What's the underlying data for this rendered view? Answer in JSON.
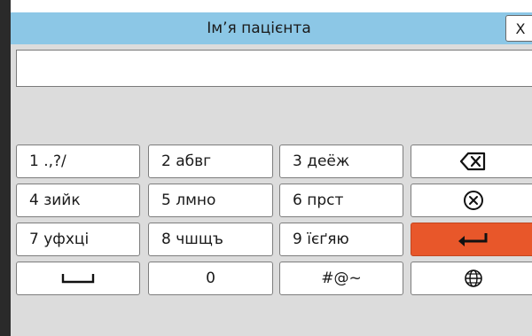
{
  "dialog": {
    "title": "Ім’я пацієнта",
    "close_label": "X"
  },
  "input": {
    "value": "",
    "placeholder": ""
  },
  "keys": {
    "row1": [
      "1  .,?/",
      "2  абвг",
      "3  деёж"
    ],
    "row2": [
      "4  зийк",
      "5  лмно",
      "6  прст"
    ],
    "row3": [
      "7  уфхці",
      "8  чшщъ",
      "9  їєґяю"
    ],
    "row4_zero": "0",
    "row4_symbols": "#@~"
  },
  "icons": {
    "backspace": "backspace-icon",
    "clear": "clear-circle-icon",
    "enter": "enter-arrow-icon",
    "space": "space-bar-icon",
    "language": "globe-icon"
  },
  "colors": {
    "titlebar": "#8cc7e6",
    "enter_key": "#e8572a"
  }
}
